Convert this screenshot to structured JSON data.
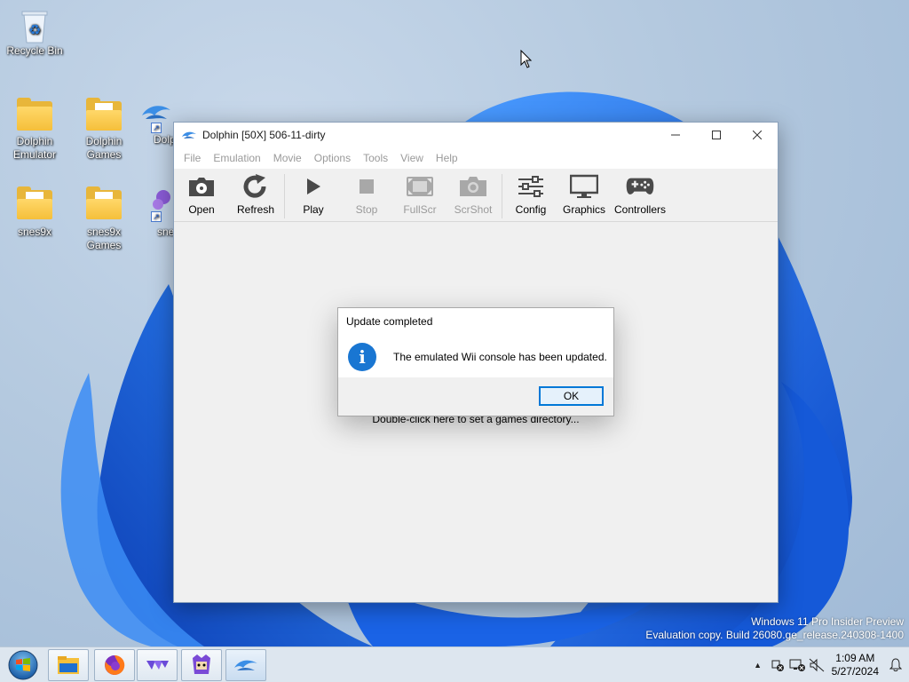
{
  "desktop": {
    "icons": [
      {
        "label": "Recycle Bin"
      },
      {
        "label": "Dolphin Emulator"
      },
      {
        "label": "Dolphin Games"
      },
      {
        "label": "Dolp"
      },
      {
        "label": "snes9x"
      },
      {
        "label": "snes9x Games"
      },
      {
        "label": "sne"
      }
    ]
  },
  "window": {
    "title": "Dolphin [50X] 506-11-dirty",
    "menu": [
      "File",
      "Emulation",
      "Movie",
      "Options",
      "Tools",
      "View",
      "Help"
    ],
    "toolbar": {
      "open": "Open",
      "refresh": "Refresh",
      "play": "Play",
      "stop": "Stop",
      "fullscr": "FullScr",
      "scrshot": "ScrShot",
      "config": "Config",
      "graphics": "Graphics",
      "controllers": "Controllers"
    },
    "gamedir_hint": "Double-click here to set a games directory..."
  },
  "dialog": {
    "title": "Update completed",
    "message": "The emulated Wii console has been updated.",
    "ok": "OK",
    "icon": "info-icon"
  },
  "watermark": {
    "line1": "Windows 11 Pro Insider Preview",
    "line2": "Evaluation copy. Build 26080.ge_release.240308-1400"
  },
  "taskbar": {
    "time": "1:09 AM",
    "date": "5/27/2024",
    "tray_expand": "▲"
  },
  "colors": {
    "accent": "#0078d7",
    "info_icon": "#1976d2",
    "folder": "#f5bf3a",
    "wallpaper_bloom": "#1e6fe0"
  }
}
